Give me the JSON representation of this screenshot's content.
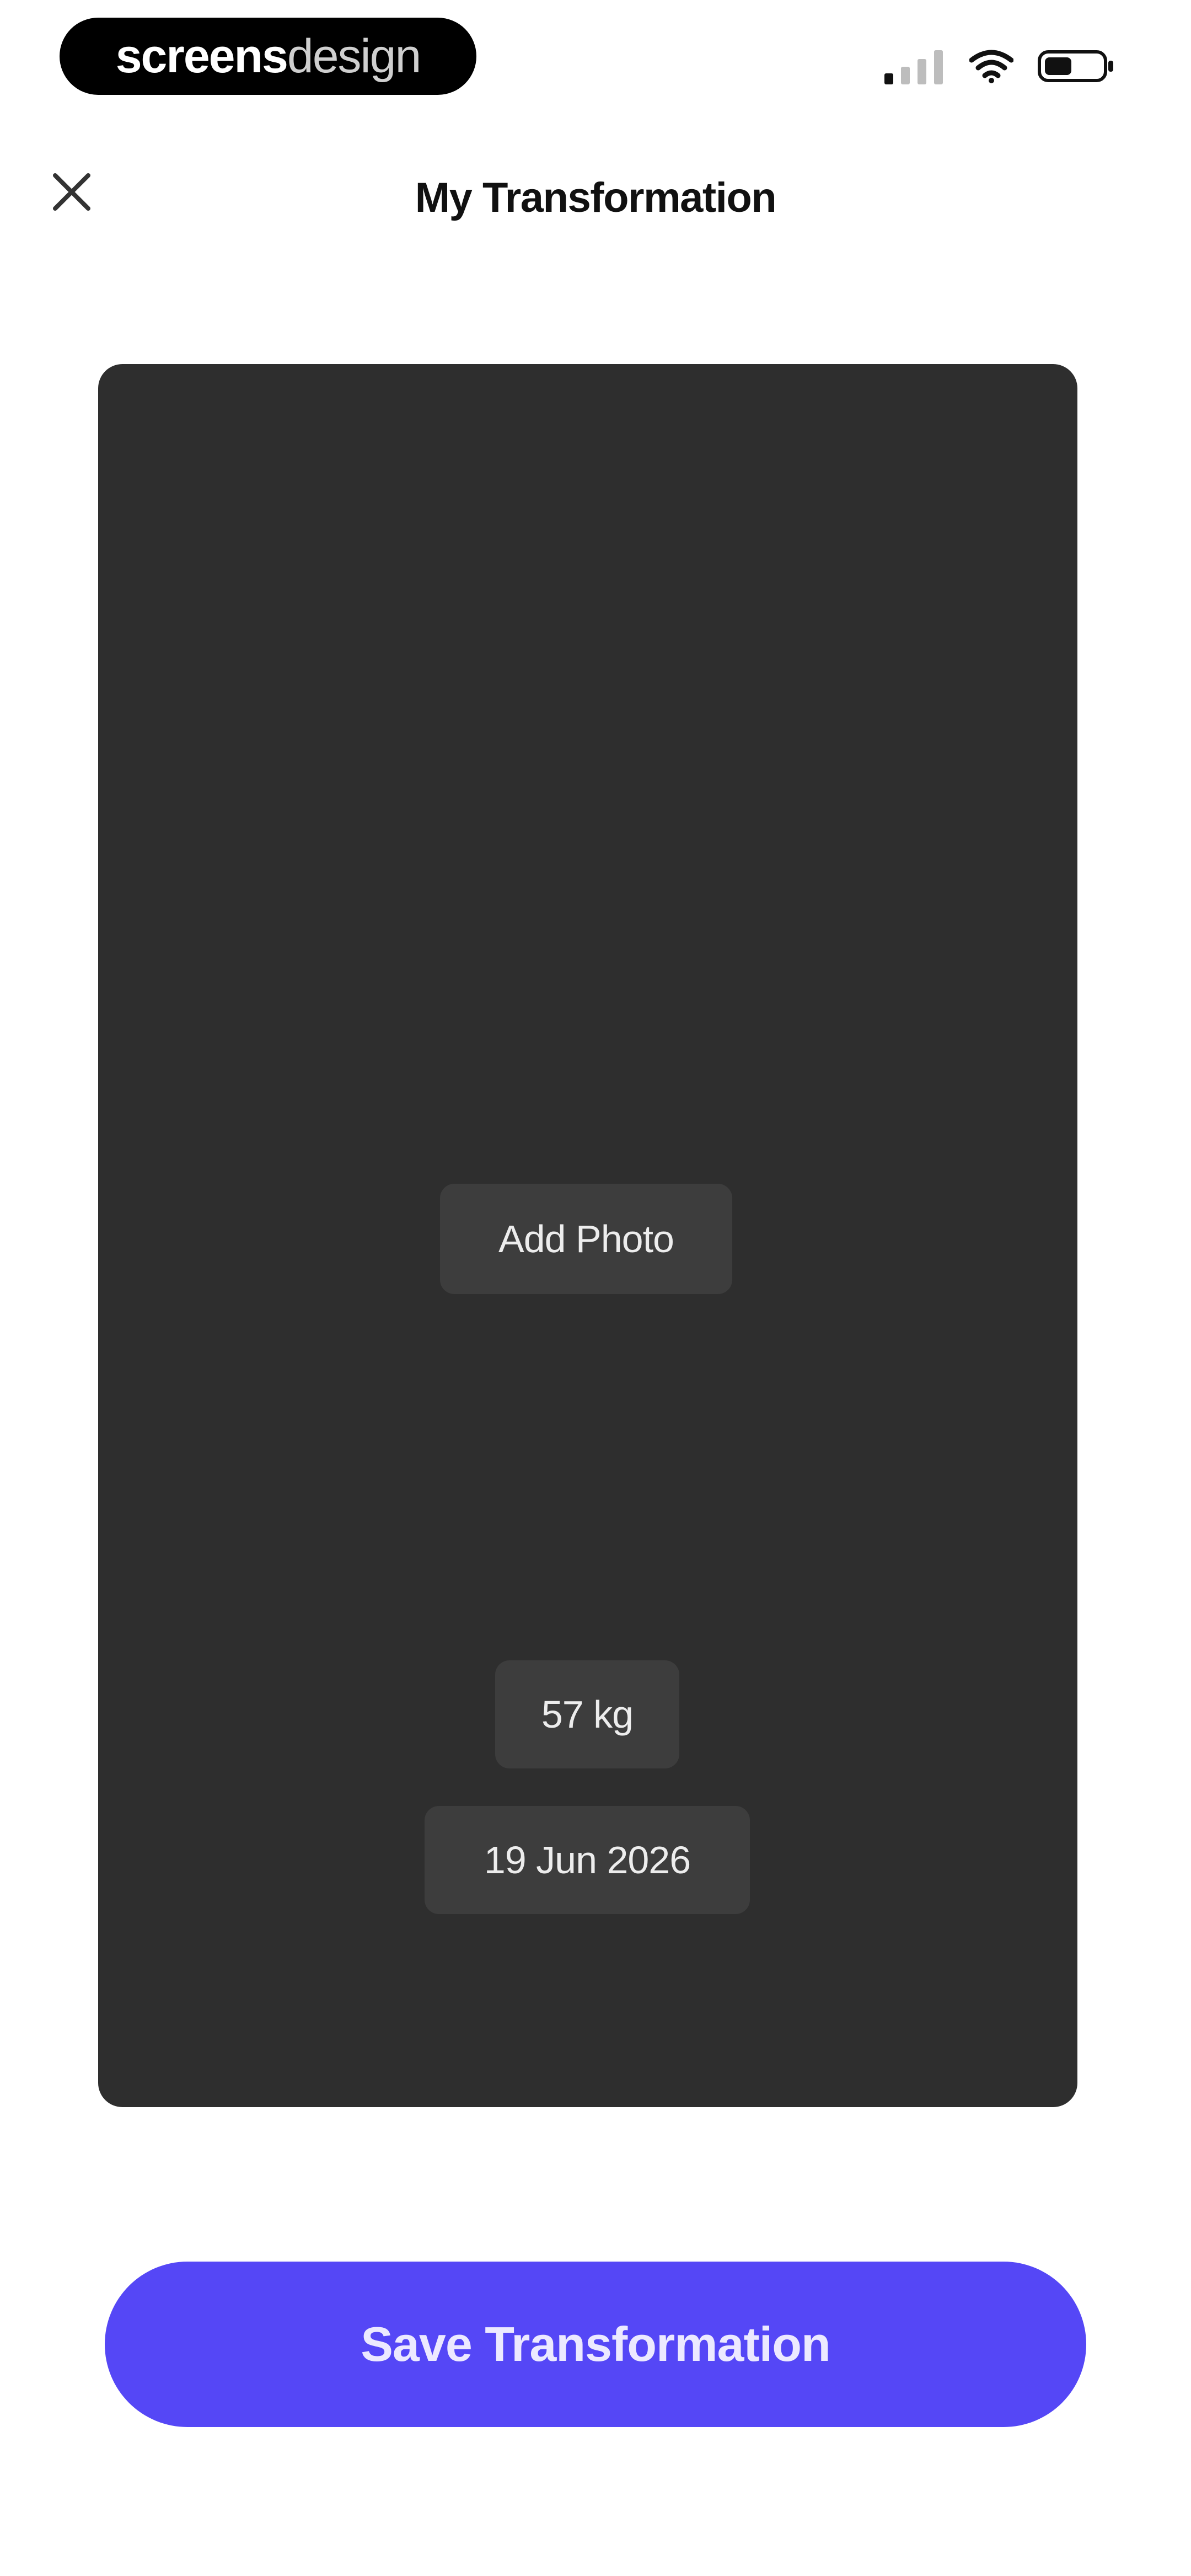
{
  "status_bar": {
    "brand_bold": "screens",
    "brand_light": "design",
    "signal_icon": "cellular-signal-icon",
    "wifi_icon": "wifi-icon",
    "battery_icon": "battery-icon"
  },
  "header": {
    "close_icon": "close-icon",
    "title": "My Transformation"
  },
  "photo_card": {
    "add_photo_label": "Add Photo",
    "weight": "57 kg",
    "date": "19 Jun 2026"
  },
  "actions": {
    "save_label": "Save Transformation"
  },
  "colors": {
    "accent": "#5547f6",
    "card_bg": "#2e2e2e",
    "chip_bg": "#3d3d3d"
  }
}
